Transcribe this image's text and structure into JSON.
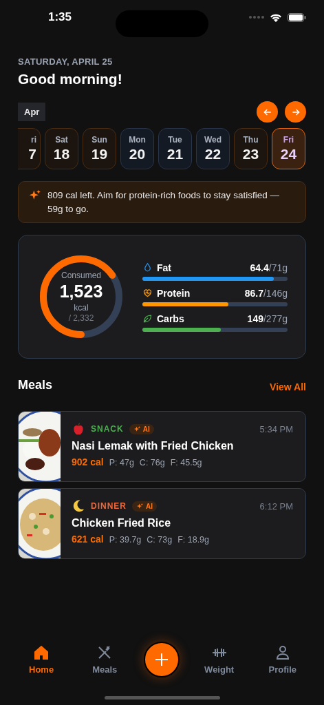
{
  "status_bar": {
    "time": "1:35"
  },
  "header": {
    "date": "SATURDAY, APRIL 25",
    "greeting": "Good morning!"
  },
  "calendar": {
    "month": "Apr",
    "days": [
      {
        "weekday": "ri",
        "day": "7",
        "color": "#4a2c12",
        "selected": false,
        "cut": true
      },
      {
        "weekday": "Sat",
        "day": "18",
        "color": "#4a2c12",
        "selected": false
      },
      {
        "weekday": "Sun",
        "day": "19",
        "color": "#4a2c12",
        "selected": false
      },
      {
        "weekday": "Mon",
        "day": "20",
        "color": "#27344a",
        "selected": false
      },
      {
        "weekday": "Tue",
        "day": "21",
        "color": "#27344a",
        "selected": false
      },
      {
        "weekday": "Wed",
        "day": "22",
        "color": "#27344a",
        "selected": false
      },
      {
        "weekday": "Thu",
        "day": "23",
        "color": "#4a2c12",
        "selected": false
      },
      {
        "weekday": "Fri",
        "day": "24",
        "color": "#e8650f",
        "selected": true
      }
    ]
  },
  "tip": {
    "text": "809 cal left. Aim for protein-rich foods to stay satisfied — 59g to go."
  },
  "summary": {
    "label": "Consumed",
    "value": "1,523",
    "unit": "kcal",
    "goal": "/ 2,332",
    "level": 0.653,
    "macros": [
      {
        "kind": "fat",
        "name": "Fat",
        "amount": "64.4",
        "target": "/71g",
        "color": "#2196f3",
        "level": 0.907
      },
      {
        "kind": "protein",
        "name": "Protein",
        "amount": "86.7",
        "target": "/146g",
        "color": "#ff9800",
        "level": 0.594
      },
      {
        "kind": "carbs",
        "name": "Carbs",
        "amount": "149",
        "target": "/277g",
        "color": "#4caf50",
        "level": 0.538
      }
    ]
  },
  "meals": {
    "title": "Meals",
    "view_all": "View All",
    "items": [
      {
        "kind": "snack",
        "category": "SNACK",
        "color": "#4caf50",
        "badge": "AI",
        "time": "5:34 PM",
        "name": "Nasi Lemak with Fried Chicken",
        "calories": "902 cal",
        "protein": "P: 47g",
        "carbs": "C: 76g",
        "fat": "F: 45.5g"
      },
      {
        "kind": "dinner",
        "category": "DINNER",
        "color": "#f0683a",
        "badge": "AI",
        "time": "6:12 PM",
        "name": "Chicken Fried Rice",
        "calories": "621 cal",
        "protein": "P: 39.7g",
        "carbs": "C: 73g",
        "fat": "F: 18.9g"
      }
    ]
  },
  "nav": {
    "items": [
      {
        "kind": "home",
        "label": "Home",
        "selected": true
      },
      {
        "kind": "meals",
        "label": "Meals",
        "selected": false
      },
      {
        "kind": "add"
      },
      {
        "kind": "weight",
        "label": "Weight",
        "selected": false
      },
      {
        "kind": "profile",
        "label": "Profile",
        "selected": false
      }
    ]
  }
}
